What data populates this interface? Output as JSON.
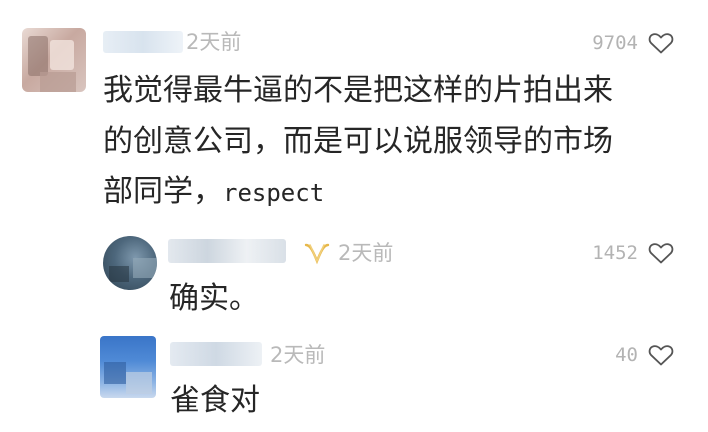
{
  "comments": [
    {
      "time": "2天前",
      "likes": "9704",
      "text_lines": [
        "我觉得最牛逼的不是把这样的片拍出来",
        "的创意公司，而是可以说服领导的市场",
        "部同学，"
      ],
      "text_tail": "respect"
    },
    {
      "time": "2天前",
      "likes": "1452",
      "text_lines": [
        "确实。"
      ],
      "badge_icon": "vip-badge-icon"
    },
    {
      "time": "2天前",
      "likes": "40",
      "text_lines": [
        "雀食对"
      ]
    }
  ],
  "icons": {
    "like": "heart-outline-icon"
  },
  "colors": {
    "badge": "#e7b84a",
    "meta_text": "#b9b9b9",
    "body_text": "#262626"
  }
}
